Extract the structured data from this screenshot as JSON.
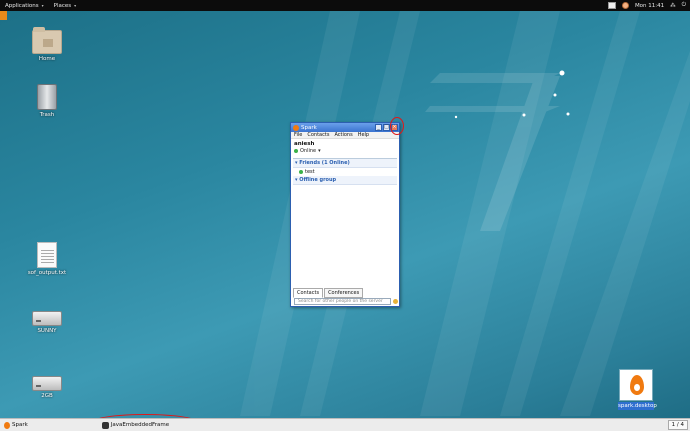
{
  "topbar": {
    "applications": "Applications",
    "places": "Places",
    "clock": "Mon 11:41"
  },
  "desktop": {
    "icons": [
      {
        "label": "Home"
      },
      {
        "label": "Trash"
      },
      {
        "label": "sof_output.txt"
      },
      {
        "label": "SUNNY"
      },
      {
        "label": "2GB"
      },
      {
        "label": "spark.desktop"
      }
    ]
  },
  "spark_window": {
    "title": "Spark",
    "menu": [
      "File",
      "Contacts",
      "Actions",
      "Help"
    ],
    "username": "aniesh",
    "status": "Online",
    "groups": [
      {
        "label": "Friends (1 Online)",
        "items": [
          "test"
        ]
      },
      {
        "label": "Offline group",
        "items": []
      }
    ],
    "tabs": [
      "Contacts",
      "Conferences"
    ],
    "search_placeholder": "Search for other people on the server"
  },
  "taskbar": {
    "items": [
      "Spark",
      "JavaEmbeddedFrame"
    ],
    "pager": "1 / 4"
  },
  "colors": {
    "annotation": "#e01818",
    "window_titlebar": "#3b74d0",
    "desktop": "#2a86a0"
  }
}
